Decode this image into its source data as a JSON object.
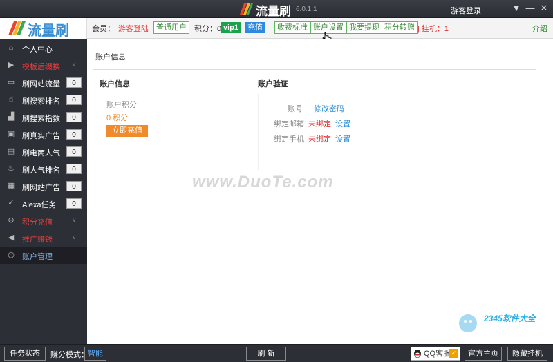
{
  "titlebar": {
    "app_name": "流量刷",
    "version": "6.0.1.1",
    "login": "游客登录",
    "menu_icon": "menu-down-icon",
    "min_icon": "minimize-icon",
    "close_icon": "close-icon"
  },
  "header": {
    "brand": "流量刷",
    "member_label": "会员：",
    "member_value": "游客登陆",
    "user_type": "普通用户",
    "points_label": "积分：0",
    "vip": "vip1",
    "recharge": "充值",
    "nav": [
      "收费标准",
      "账户设置",
      "我要提现",
      "积分转赠"
    ],
    "hangup": "| 挂机：1",
    "intro": "介绍"
  },
  "sidebar": {
    "items": [
      {
        "label": "个人中心",
        "icon": "home-icon"
      },
      {
        "label": "模板后缀换",
        "icon": "play-icon",
        "red": true
      },
      {
        "label": "刷网站流量",
        "icon": "monitor-icon",
        "count": "0"
      },
      {
        "label": "刷搜索排名",
        "icon": "pointer-icon",
        "count": "0"
      },
      {
        "label": "刷搜索指数",
        "icon": "chart-icon",
        "count": "0"
      },
      {
        "label": "刷真实广告",
        "icon": "ad-icon",
        "count": "0"
      },
      {
        "label": "刷电商人气",
        "icon": "bag-icon",
        "count": "0"
      },
      {
        "label": "刷人气排名",
        "icon": "fire-icon",
        "count": "0"
      },
      {
        "label": "刷网站广告",
        "icon": "gift-icon",
        "count": "0"
      },
      {
        "label": "Alexa任务",
        "icon": "check-circle-icon",
        "count": "0"
      },
      {
        "label": "积分充值",
        "icon": "coin-icon",
        "red": true
      },
      {
        "label": "推广赚钱",
        "icon": "megaphone-icon",
        "red": true
      },
      {
        "label": "账户管理",
        "icon": "shield-icon",
        "active": true
      }
    ]
  },
  "main": {
    "page_title": "账户信息",
    "account_info": {
      "title": "账户信息",
      "points_label": "账户积分",
      "points_value": "0 积分",
      "recharge_btn": "立即充值"
    },
    "verify": {
      "title": "账户验证",
      "rows": [
        {
          "label": "账号",
          "status": "",
          "action": "修改密码"
        },
        {
          "label": "绑定邮箱",
          "status": "未绑定",
          "action": "设置"
        },
        {
          "label": "绑定手机",
          "status": "未绑定",
          "action": "设置"
        }
      ]
    }
  },
  "watermark": "www.DuoTe.com",
  "corner_watermark": "2345软件大全",
  "bottom": {
    "task_status": "任务状态",
    "mode_label": "赚分模式：",
    "mode_value": "智能",
    "refresh": "刷 新",
    "qq": "QQ客服",
    "homepage": "官方主页",
    "hide": "隐藏挂机"
  },
  "colors": {
    "sidebar_bg": "#2c2f36",
    "accent_green": "#5cb85c",
    "orange": "#f08b2c",
    "red": "#e03030",
    "blue": "#2a8bd6"
  }
}
